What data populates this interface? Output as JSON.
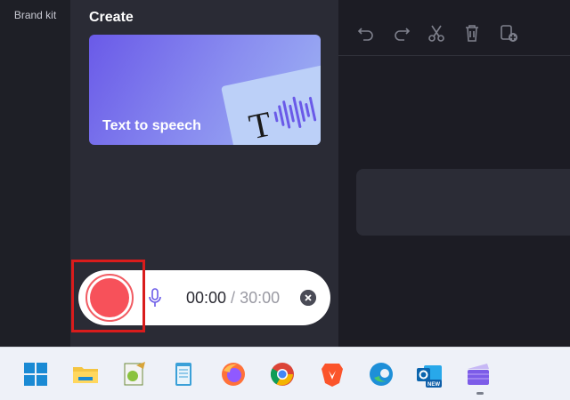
{
  "left_rail": {
    "brand_kit": "Brand kit"
  },
  "panel": {
    "title": "Create",
    "tts_card": {
      "label": "Text to speech",
      "glyph": "T"
    }
  },
  "toolbar": {
    "icons": [
      "undo-icon",
      "redo-icon",
      "cut-icon",
      "trash-icon",
      "add-clip-icon"
    ]
  },
  "recorder": {
    "elapsed": "00:00",
    "separator": " / ",
    "total": "30:00",
    "record_color": "#f7515a"
  },
  "taskbar": {
    "apps": [
      "windows-start-icon",
      "file-explorer-icon",
      "notepad-plus-plus-icon",
      "notepad-icon",
      "firefox-icon",
      "chrome-icon",
      "brave-icon",
      "edge-icon",
      "outlook-new-icon",
      "clipchamp-icon"
    ],
    "outlook_badge": "NEW"
  },
  "colors": {
    "accent": "#6a5ae8",
    "highlight": "#d91c1c"
  }
}
